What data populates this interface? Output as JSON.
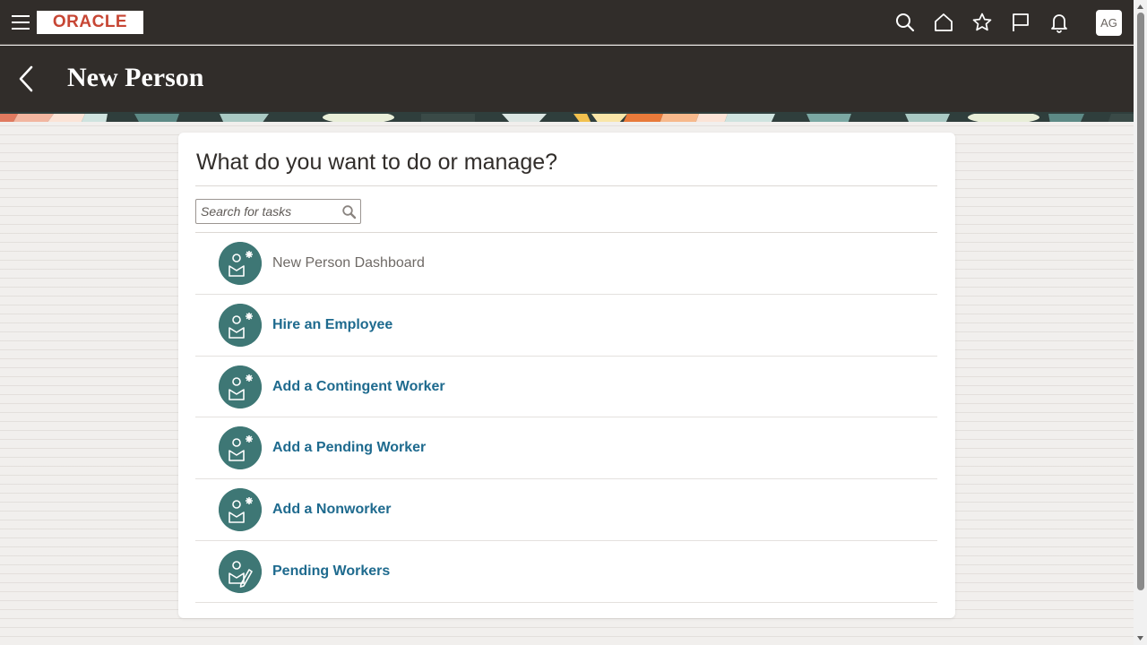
{
  "header": {
    "logo_text": "ORACLE",
    "avatar_initials": "AG"
  },
  "page": {
    "title": "New Person"
  },
  "card": {
    "title": "What do you want to do or manage?",
    "search_placeholder": "Search for tasks"
  },
  "tasks": [
    {
      "label": "New Person Dashboard",
      "icon": "new-person-icon",
      "active": false
    },
    {
      "label": "Hire an Employee",
      "icon": "new-person-icon",
      "active": true
    },
    {
      "label": "Add a Contingent Worker",
      "icon": "new-person-icon",
      "active": true
    },
    {
      "label": "Add a Pending Worker",
      "icon": "new-person-icon",
      "active": true
    },
    {
      "label": "Add a Nonworker",
      "icon": "new-person-icon",
      "active": true
    },
    {
      "label": "Pending Workers",
      "icon": "edit-person-icon",
      "active": true
    }
  ],
  "colors": {
    "header_bg": "#312d2a",
    "link": "#1e6a8e",
    "icon_circle": "#3e7775",
    "brand_red": "#c74634"
  }
}
